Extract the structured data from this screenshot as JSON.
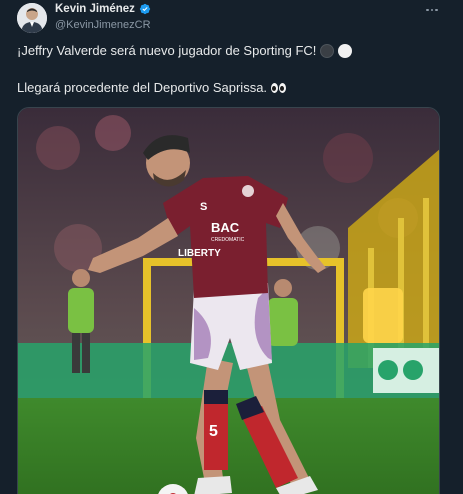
{
  "author": {
    "display_name": "Kevin Jiménez",
    "handle": "@KevinJimenezCR",
    "verified_icon": "verified-badge-icon"
  },
  "tweet": {
    "line1": "¡Jeffry Valverde será nuevo jugador de Sporting FC!",
    "line1_emoji": [
      "black-circle-icon",
      "white-circle-icon"
    ],
    "line2": "Llegará procedente del Deportivo Saprissa.",
    "line2_emoji": "eyes-icon"
  },
  "media": {
    "jersey_logo_text": "BAC",
    "jersey_sub_text": "CREDOMATIC",
    "jersey_sponsor_text": "LIBERTY",
    "sock_number": "5",
    "jersey_badge": "S"
  },
  "colors": {
    "background": "#15202b",
    "accent_verified": "#1d9bf0",
    "text_primary": "#e7e9ea",
    "text_secondary": "#8b98a5",
    "jersey": "#7a1f2f"
  }
}
